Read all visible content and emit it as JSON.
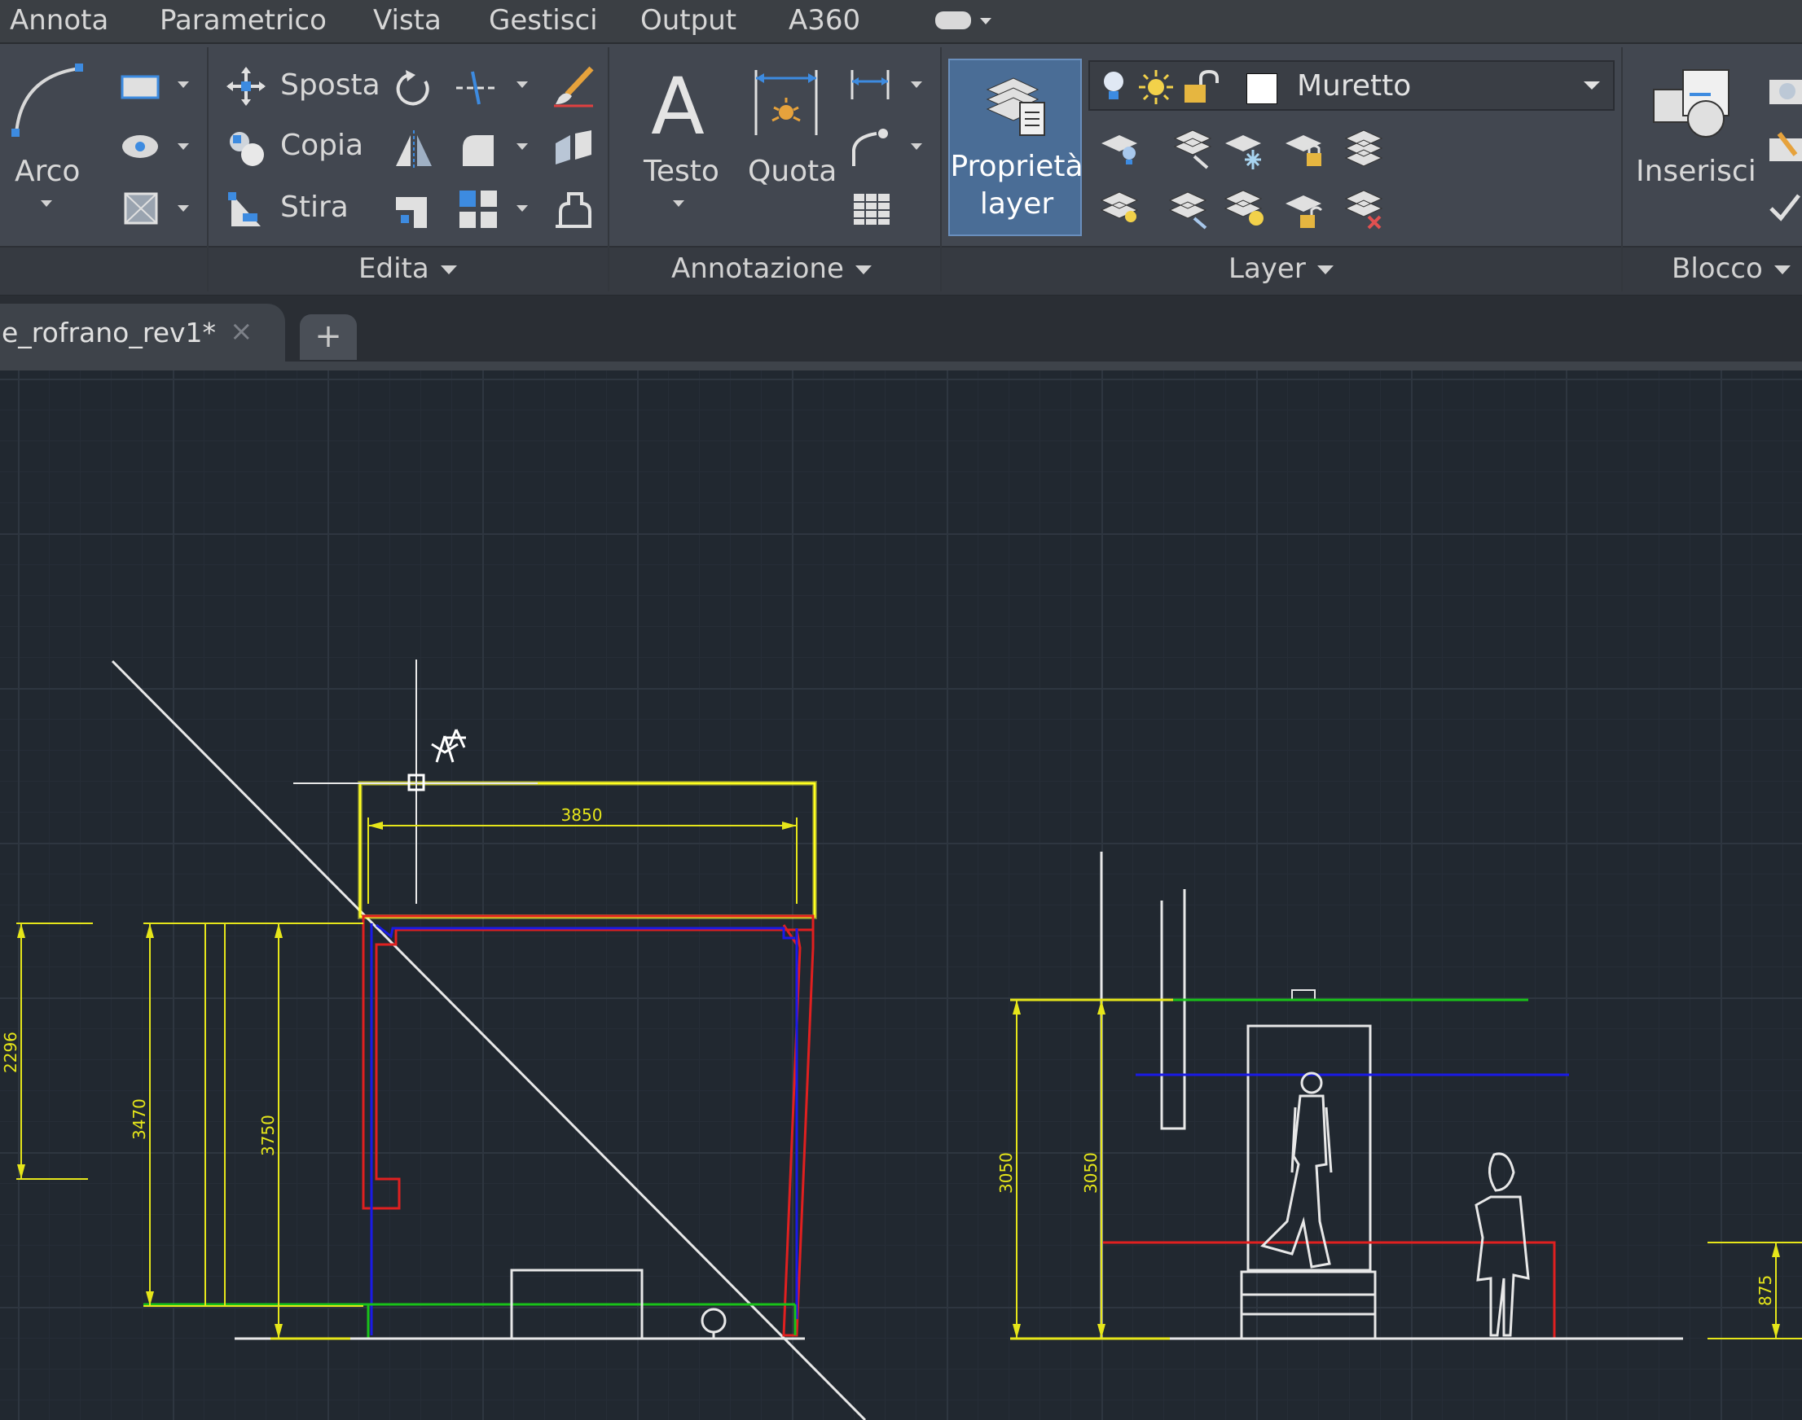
{
  "menu": {
    "items": [
      "Annota",
      "Parametrico",
      "Vista",
      "Gestisci",
      "Output",
      "A360"
    ]
  },
  "ribbon": {
    "draw": {
      "arc_label": "Arco"
    },
    "edit": {
      "move_label": "Sposta",
      "copy_label": "Copia",
      "stretch_label": "Stira",
      "panel_title": "Edita"
    },
    "annotation": {
      "text_label": "Testo",
      "dimension_label": "Quota",
      "panel_title": "Annotazione"
    },
    "layer": {
      "properties_label_line1": "Proprietà",
      "properties_label_line2": "layer",
      "current_layer": "Muretto",
      "panel_title": "Layer"
    },
    "block": {
      "insert_label": "Inserisci",
      "panel_title": "Blocco"
    }
  },
  "tabs": {
    "document": "e_rofrano_rev1*",
    "close_glyph": "×",
    "new_tab_glyph": "+"
  },
  "drawing": {
    "dimensions": {
      "width_top": "3850",
      "left_outer": "2296",
      "left_inner_a": "3470",
      "left_inner_b": "3750",
      "section_height_a": "3050",
      "section_height_b": "3050",
      "right_small": "875"
    }
  },
  "colors": {
    "ribbon_bg": "#424750",
    "canvas_bg": "#212830",
    "active_button": "#4a6d96",
    "dim_yellow": "#e6e61a",
    "wall_red": "#e02020",
    "line_blue": "#1a1ae6",
    "line_green": "#19c219"
  }
}
